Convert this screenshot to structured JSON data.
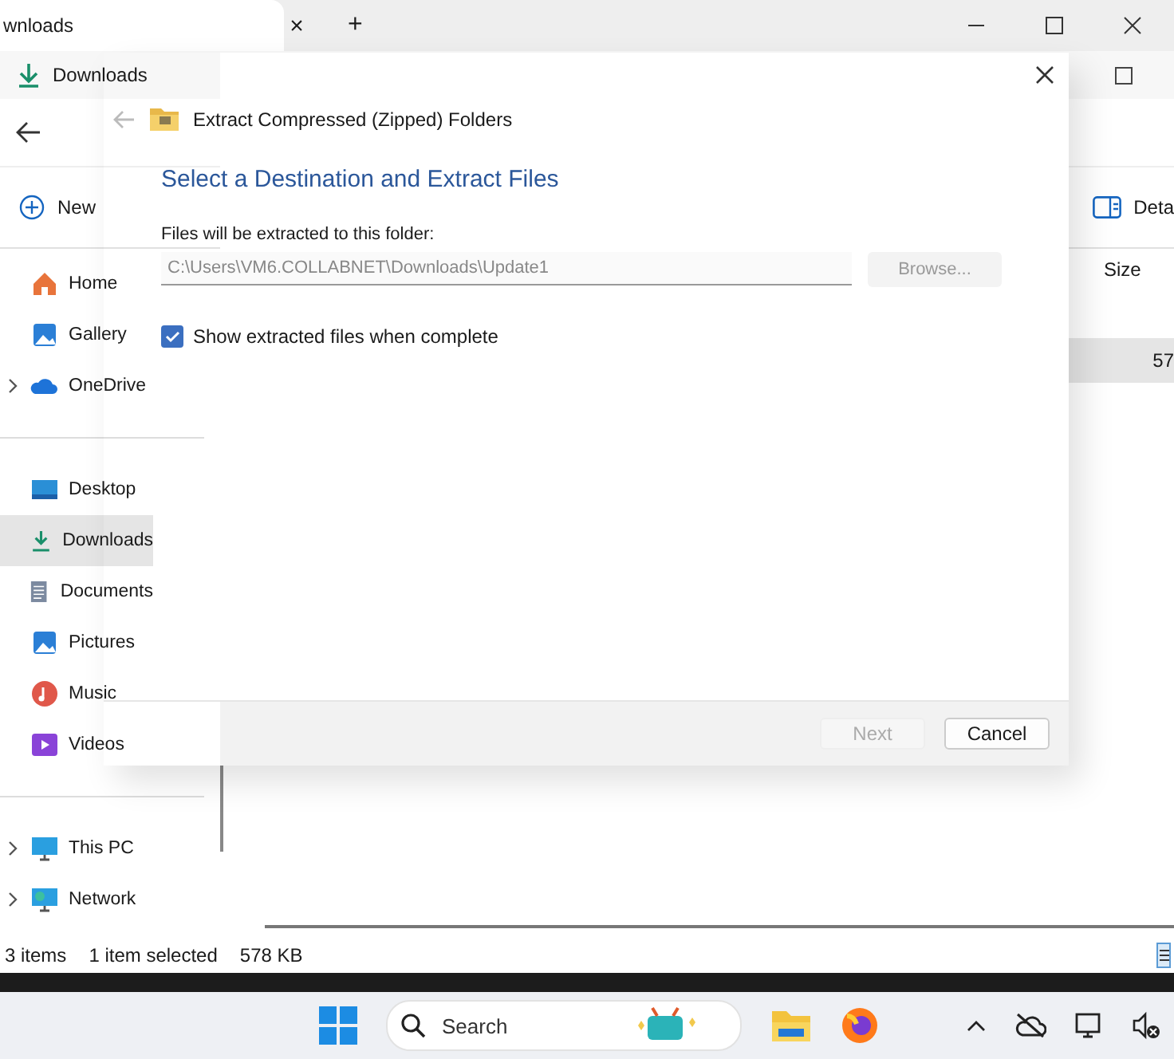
{
  "front_tab": {
    "title": "wnloads",
    "close": "×",
    "add": "+"
  },
  "back_window": {
    "title": "Downloads"
  },
  "command_bar": {
    "new_label": "New",
    "details_label": "Deta"
  },
  "sidebar": {
    "sections": [
      {
        "items": [
          {
            "label": "Home",
            "expandable": false,
            "selected": false
          },
          {
            "label": "Gallery",
            "expandable": false,
            "selected": false
          },
          {
            "label": "OneDrive",
            "expandable": true,
            "selected": false
          }
        ]
      },
      {
        "items": [
          {
            "label": "Desktop",
            "expandable": false,
            "selected": false
          },
          {
            "label": "Downloads",
            "expandable": false,
            "selected": true
          },
          {
            "label": "Documents",
            "expandable": false,
            "selected": false
          },
          {
            "label": "Pictures",
            "expandable": false,
            "selected": false
          },
          {
            "label": "Music",
            "expandable": false,
            "selected": false
          },
          {
            "label": "Videos",
            "expandable": false,
            "selected": false
          }
        ]
      },
      {
        "items": [
          {
            "label": "This PC",
            "expandable": true,
            "selected": false
          },
          {
            "label": "Network",
            "expandable": true,
            "selected": false
          }
        ]
      }
    ]
  },
  "file_list": {
    "size_column": "Size",
    "selected_row_size": "57"
  },
  "status_bar": {
    "count": "3 items",
    "selection": "1 item selected",
    "size": "578 KB"
  },
  "taskbar": {
    "search": {
      "placeholder": "Search"
    }
  },
  "dialog": {
    "title": "Extract Compressed (Zipped) Folders",
    "heading": "Select a Destination and Extract Files",
    "field_label": "Files will be extracted to this folder:",
    "path": "C:\\Users\\VM6.COLLABNET\\Downloads\\Update1",
    "browse": "Browse...",
    "show_files": {
      "label": "Show extracted files when complete",
      "checked": true
    },
    "buttons": [
      {
        "label": "Next",
        "disabled": true
      },
      {
        "label": "Cancel",
        "disabled": false
      }
    ]
  }
}
